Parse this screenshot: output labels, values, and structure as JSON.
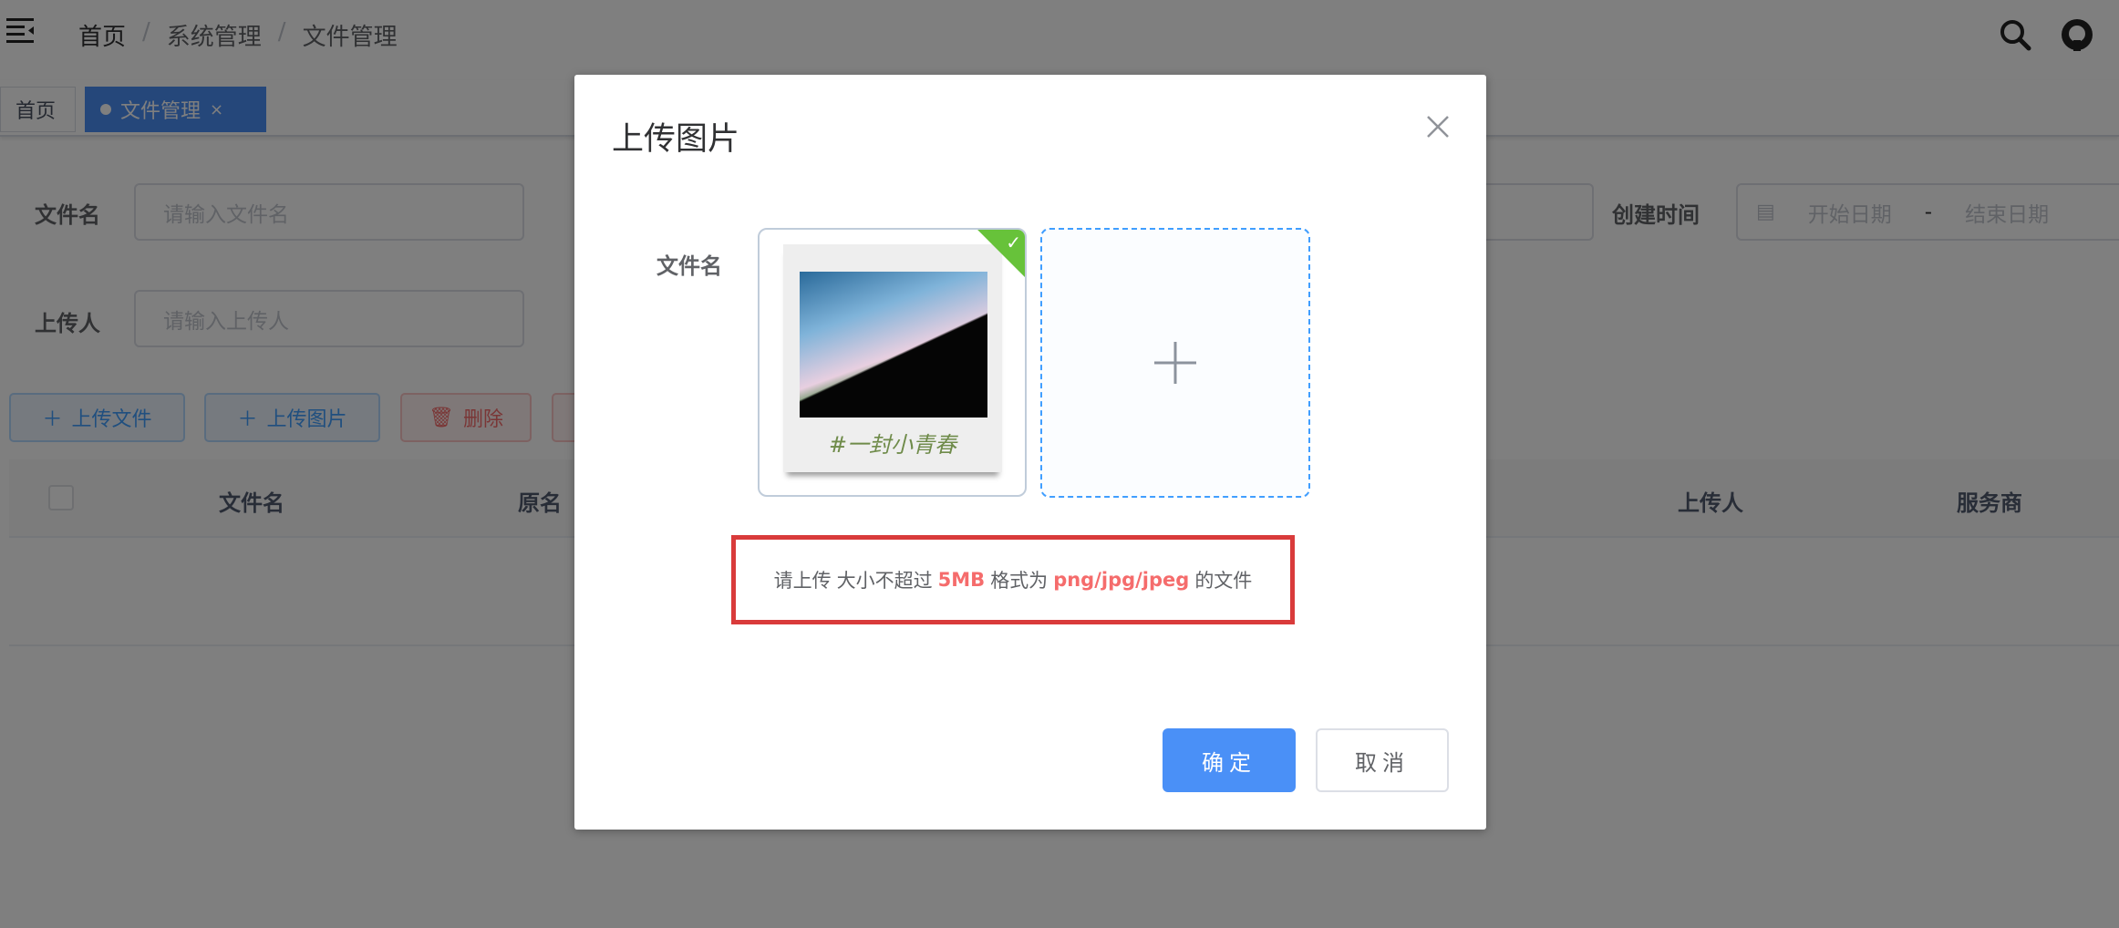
{
  "header": {
    "breadcrumb": [
      "首页",
      "系统管理",
      "文件管理"
    ],
    "separator": "/",
    "icons": [
      "hamburger-icon",
      "search-icon",
      "github-icon"
    ]
  },
  "tabs": [
    {
      "label": "首页"
    },
    {
      "label": "文件管理",
      "close": "×"
    }
  ],
  "filters": {
    "filename": {
      "label": "文件名",
      "placeholder": "请输入文件名"
    },
    "uploader": {
      "label": "上传人",
      "placeholder": "请输入上传人"
    },
    "created": {
      "label": "创建时间",
      "start": "开始日期",
      "sep": "-",
      "end": "结束日期"
    }
  },
  "toolbar": {
    "upload_file": "上传文件",
    "upload_image": "上传图片",
    "delete": "删除"
  },
  "table": {
    "columns": [
      "文件名",
      "原名",
      "上传人",
      "服务商"
    ]
  },
  "modal": {
    "title": "上传图片",
    "field_label": "文件名",
    "image_caption": "#一封小青春",
    "hint": {
      "p1": "请上传",
      "p2": "大小不超过",
      "size": "5MB",
      "p3": "格式为",
      "formats": "png/jpg/jpeg",
      "p4": "的文件"
    },
    "ok": "确定",
    "cancel": "取消"
  },
  "colors": {
    "primary": "#409eff",
    "danger": "#f56c6c",
    "success": "#67c23a",
    "highlight": "#d93b3b"
  }
}
